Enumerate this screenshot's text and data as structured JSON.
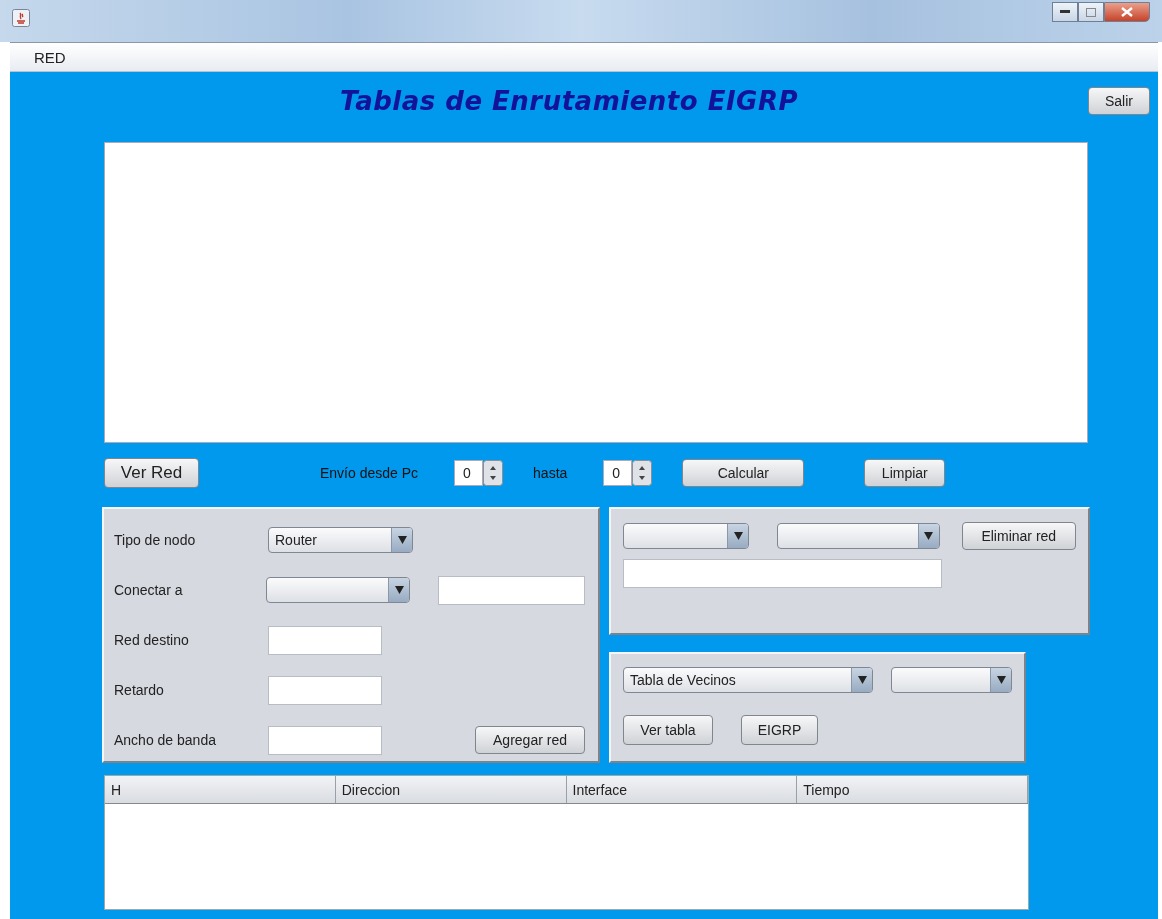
{
  "menu": [
    "RED"
  ],
  "title": "Tablas de Enrutamiento EIGRP",
  "exit_button": "Salir",
  "controls": {
    "view_button": "Ver Red",
    "from_label": "Envío desde Pc",
    "from_value": "0",
    "to_label": "hasta",
    "to_value": "0",
    "calculate_button": "Calcular",
    "clear_button": "Limpiar"
  },
  "node_panel": {
    "fields": [
      {
        "label": "Tipo de nodo",
        "kind": "select",
        "value": "Router"
      },
      {
        "label": "Conectar a",
        "kind": "select_text"
      },
      {
        "label": "Red destino",
        "kind": "text"
      },
      {
        "label": "Retardo",
        "kind": "text"
      },
      {
        "label": "Ancho de banda",
        "kind": "text"
      }
    ],
    "add_button": "Agregar red"
  },
  "delete_panel": {
    "delete_button": "Eliminar red"
  },
  "table_panel": {
    "table_select": "Tabla de Vecinos",
    "view_button": "Ver tabla",
    "eigrp_button": "EIGRP"
  },
  "table": {
    "columns": [
      "H",
      "Direccion",
      "Interface",
      "Tiempo"
    ]
  }
}
